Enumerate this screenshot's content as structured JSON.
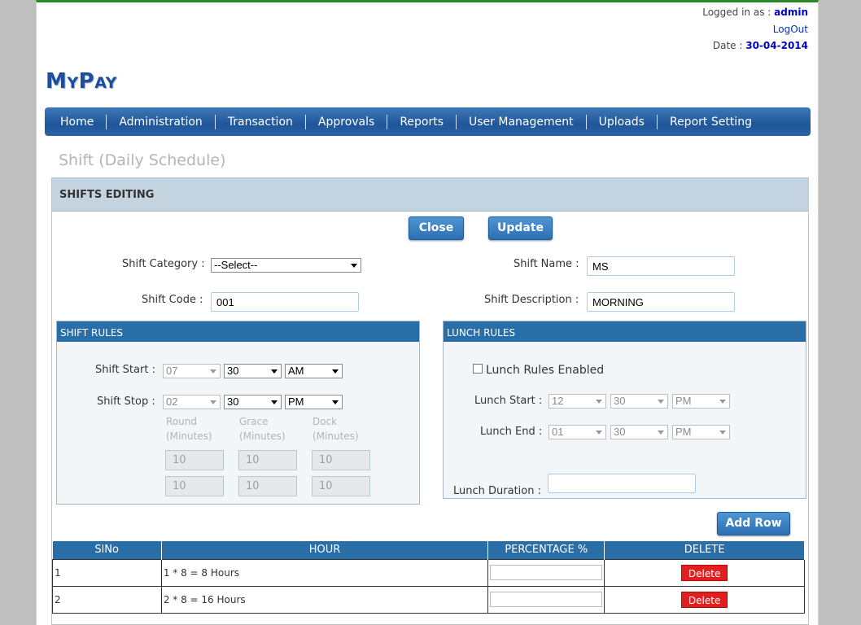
{
  "header": {
    "logged_label": "Logged in as :",
    "user": "admin",
    "logout": "LogOut",
    "date_label": "Date :",
    "date": "30-04-2014"
  },
  "logo": {
    "first_big": "M",
    "first_rest": "Y",
    "second_big": "P",
    "second_rest": "AY"
  },
  "nav": [
    "Home",
    "Administration",
    "Transaction",
    "Approvals",
    "Reports",
    "User Management",
    "Uploads",
    "Report Setting"
  ],
  "page_title": "Shift (Daily Schedule)",
  "panel_title": "SHIFTS EDITING",
  "buttons": {
    "close": "Close",
    "update": "Update",
    "add_row": "Add Row"
  },
  "form": {
    "shift_category_label": "Shift Category :",
    "shift_category_value": "--Select--",
    "shift_name_label": "Shift Name :",
    "shift_name_value": "MS",
    "shift_code_label": "Shift Code :",
    "shift_code_value": "001",
    "shift_desc_label": "Shift Description :",
    "shift_desc_value": "MORNING"
  },
  "shift_rules": {
    "title": "SHIFT RULES",
    "start_label": "Shift Start :",
    "start_hour": "07",
    "start_min": "30",
    "start_ampm": "AM",
    "stop_label": "Shift Stop :",
    "stop_hour": "02",
    "stop_min": "30",
    "stop_ampm": "PM",
    "round_label": "Round",
    "grace_label": "Grace",
    "dock_label": "Dock",
    "minutes_label": "(Minutes)",
    "row1": [
      "10",
      "10",
      "10"
    ],
    "row2": [
      "10",
      "10",
      "10"
    ]
  },
  "lunch_rules": {
    "title": "LUNCH RULES",
    "enabled_label": "Lunch Rules Enabled",
    "start_label": "Lunch Start :",
    "start_hour": "12",
    "start_min": "30",
    "start_ampm": "PM",
    "end_label": "Lunch End :",
    "end_hour": "01",
    "end_min": "30",
    "end_ampm": "PM",
    "duration_label": "Lunch Duration :"
  },
  "table": {
    "headers": [
      "SlNo",
      "HOUR",
      "PERCENTAGE %",
      "DELETE"
    ],
    "rows": [
      {
        "slno": "1",
        "hour": "1 * 8 = 8 Hours",
        "delete": "Delete"
      },
      {
        "slno": "2",
        "hour": "2 * 8 = 16 Hours",
        "delete": "Delete"
      }
    ]
  }
}
